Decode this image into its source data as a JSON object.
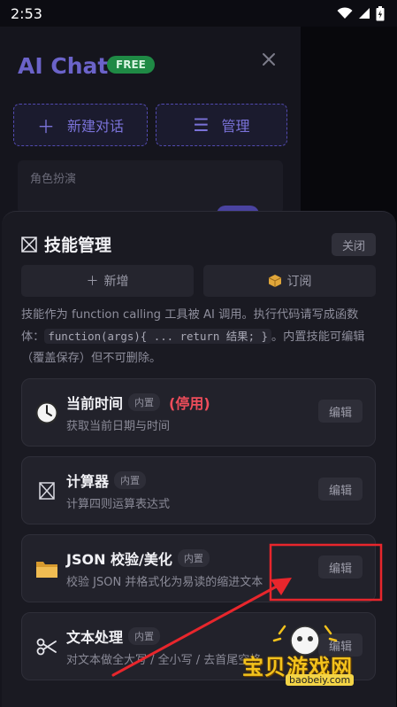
{
  "status": {
    "time": "2:53"
  },
  "drawer": {
    "title": "AI Chat",
    "badge": "FREE",
    "new_chat": "新建对话",
    "manage": "管理",
    "roleplay_label": "角色扮演"
  },
  "sheet": {
    "title": "技能管理",
    "close": "关闭",
    "add": "新增",
    "subscribe": "订阅",
    "desc_part1": "技能作为 function calling 工具被 AI 调用。执行代码请写成函数体：",
    "desc_code": "function(args){ ... return 结果; }",
    "desc_part2": "。内置技能可编辑（覆盖保存）但不可删除。"
  },
  "skills": [
    {
      "name": "当前时间",
      "tag": "内置",
      "status": "(停用)",
      "desc": "获取当前日期与时间",
      "edit": "编辑",
      "icon": "clock-icon"
    },
    {
      "name": "计算器",
      "tag": "内置",
      "status": "",
      "desc": "计算四则运算表达式",
      "edit": "编辑",
      "icon": "calculator-icon"
    },
    {
      "name": "JSON 校验/美化",
      "tag": "内置",
      "status": "",
      "desc": "校验 JSON 并格式化为易读的缩进文本",
      "edit": "编辑",
      "icon": "folder-icon"
    },
    {
      "name": "文本处理",
      "tag": "内置",
      "status": "",
      "desc": "对文本做全大写 / 全小写 / 去首尾空格",
      "edit": "编辑",
      "icon": "scissors-icon"
    }
  ],
  "watermark": {
    "name": "宝贝游戏网",
    "url": "baobeiy.com"
  },
  "colors": {
    "accent": "#6b63c9",
    "danger": "#ef4d5b",
    "annotation": "#e8262c",
    "badge": "#1f8a45"
  }
}
